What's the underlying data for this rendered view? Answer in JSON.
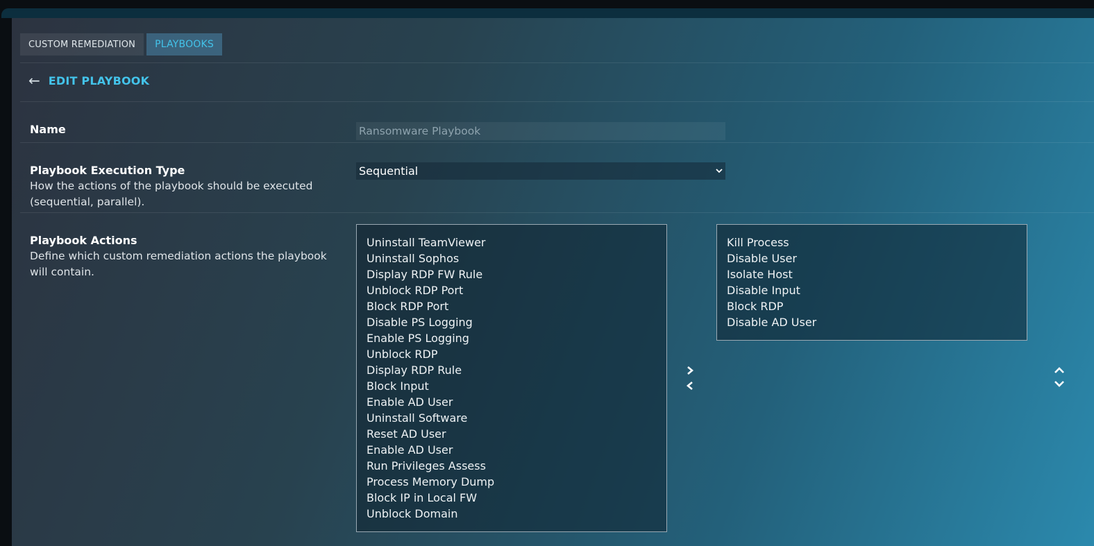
{
  "tabs": [
    {
      "label": "CUSTOM REMEDIATION",
      "active": false
    },
    {
      "label": "PLAYBOOKS",
      "active": true
    }
  ],
  "header": {
    "back_icon": "arrow-left-icon",
    "title": "EDIT PLAYBOOK"
  },
  "fields": {
    "name": {
      "label": "Name",
      "value": "Ransomware Playbook"
    },
    "execution_type": {
      "label": "Playbook Execution Type",
      "description": "How the actions of the playbook should be executed (sequential, parallel).",
      "selected": "Sequential"
    },
    "actions": {
      "label": "Playbook Actions",
      "description": "Define which custom remediation actions the playbook will contain."
    }
  },
  "available_actions": [
    "Uninstall TeamViewer",
    "Uninstall Sophos",
    "Display RDP FW Rule",
    "Unblock RDP Port",
    "Block RDP Port",
    "Disable PS Logging",
    "Enable PS Logging",
    "Unblock RDP",
    "Display RDP Rule",
    "Block Input",
    "Enable AD User",
    "Uninstall Software",
    "Reset AD User",
    "Enable AD User",
    "Run Privileges Assess",
    "Process Memory Dump",
    "Block IP in Local FW",
    "Unblock Domain"
  ],
  "selected_actions": [
    "Kill Process",
    "Disable User",
    "Isolate Host",
    "Disable Input",
    "Block RDP",
    "Disable AD User"
  ],
  "colors": {
    "accent": "#43c3ea",
    "text": "#ffffff",
    "border": "#9aa9b3"
  },
  "icons": {
    "add": "chevron-right-icon",
    "remove": "chevron-left-icon",
    "move_up": "chevron-up-icon",
    "move_down": "chevron-down-icon",
    "select": "chevron-down-icon"
  }
}
